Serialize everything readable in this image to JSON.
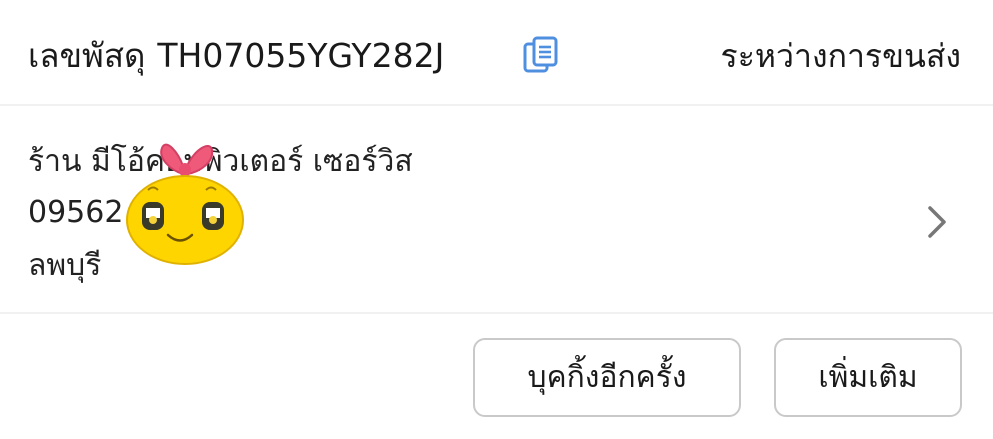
{
  "header": {
    "tracking_label": "เลขพัสดุ",
    "tracking_number": "TH07055YGY282J",
    "copy_icon": "copy-icon",
    "status": "ระหว่างการขนส่ง"
  },
  "shop": {
    "name": "ร้าน มีโอ้คอมพิวเตอร์ เซอร์วิส",
    "phone": "09562",
    "province": "ลพบุรี",
    "chevron_icon": "chevron-right-icon"
  },
  "actions": {
    "rebook_label": "บุคกิ้งอีกครั้ง",
    "more_label": "เพิ่มเติม"
  },
  "colors": {
    "accent_icon": "#4f8fe0",
    "border": "#c9c9c9",
    "divider": "#f1f1f1"
  }
}
